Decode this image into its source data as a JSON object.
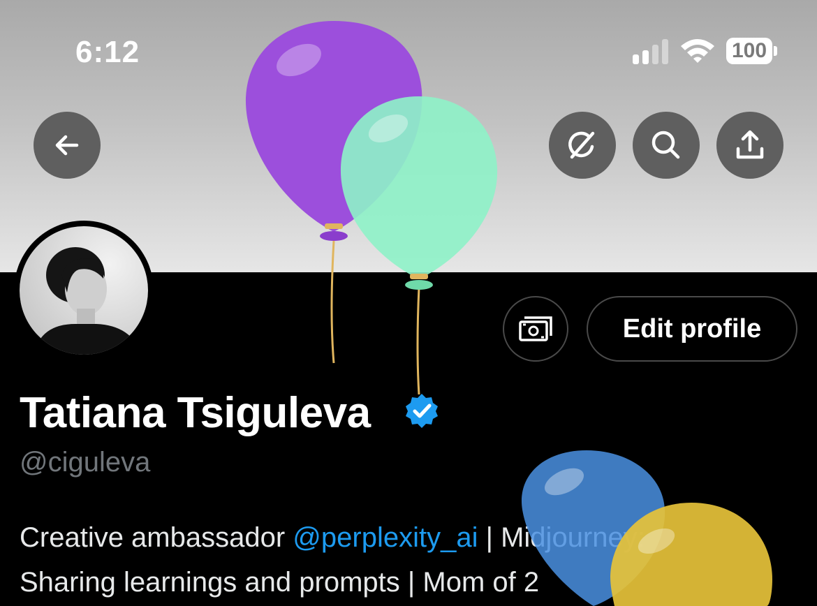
{
  "status_bar": {
    "time": "6:12",
    "battery": "100"
  },
  "header": {
    "back_icon": "arrow-left-icon",
    "grok_icon": "grok-icon",
    "search_icon": "search-icon",
    "share_icon": "share-icon"
  },
  "profile": {
    "name": "Tatiana Tsiguleva",
    "handle": "@ciguleva",
    "verified": true,
    "edit_label": "Edit profile",
    "tip_icon": "money-icon",
    "bio": {
      "part1": "Creative ambassador ",
      "mention": "@perplexity_ai",
      "part2": " | Midjourney:",
      "line2": "Sharing learnings and prompts | Mom of 2"
    }
  },
  "colors": {
    "accent": "#1d9bf0",
    "background": "#000000",
    "secondary_text": "#71767b"
  }
}
